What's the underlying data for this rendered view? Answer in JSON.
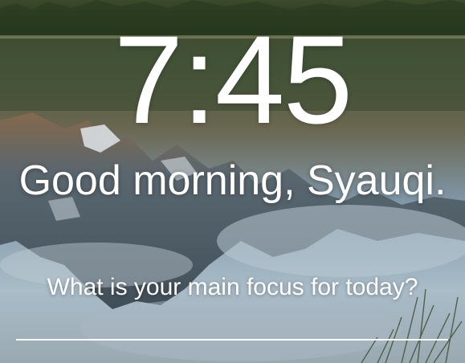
{
  "clock": {
    "time": "7:45"
  },
  "greeting": {
    "text": "Good morning, Syauqi."
  },
  "focus": {
    "prompt": "What is your main focus for today?",
    "input_value": ""
  },
  "background": {
    "scene": "mountain-lake-reflection",
    "colors": {
      "forest": "#2f3d22",
      "water": "#5f7a86",
      "sky_reflection": "#9fb4c2",
      "mountain": "#3c4a55"
    }
  }
}
